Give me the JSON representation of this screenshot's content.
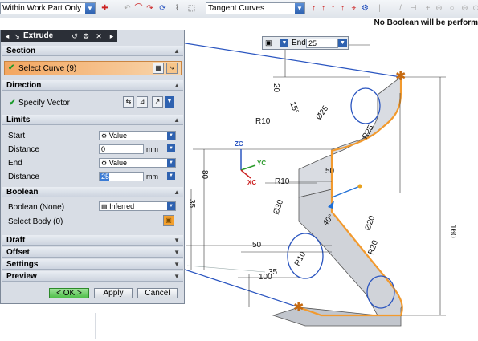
{
  "toolbar": {
    "filter_value": "Within Work Part Only",
    "curve_rule_value": "Tangent Curves"
  },
  "status": {
    "message": "No Boolean will be perform"
  },
  "dialog": {
    "title": "Extrude",
    "sections": {
      "section": "Section",
      "direction": "Direction",
      "limits": "Limits",
      "boolean": "Boolean",
      "draft": "Draft",
      "offset": "Offset",
      "settings": "Settings",
      "preview": "Preview"
    },
    "select_curve": "Select Curve (9)",
    "specify_vector": "Specify Vector",
    "limits": {
      "start_label": "Start",
      "start_value": "Value",
      "start_distance_label": "Distance",
      "start_distance": "0",
      "start_units": "mm",
      "end_label": "End",
      "end_value": "Value",
      "end_distance_label": "Distance",
      "end_distance": "25",
      "end_units": "mm"
    },
    "boolean": {
      "label": "Boolean (None)",
      "value": "Inferred",
      "select_body": "Select Body (0)"
    },
    "buttons": {
      "ok": "< OK >",
      "apply": "Apply",
      "cancel": "Cancel"
    }
  },
  "end_handle": {
    "label": "End",
    "value": "25"
  },
  "drawing": {
    "dims": [
      "20",
      "15°",
      "Ø25",
      "R25",
      "R10",
      "50",
      "R10",
      "80",
      "35",
      "Ø30",
      "40°",
      "Ø20",
      "R20",
      "R10",
      "50",
      "35",
      "100",
      "160"
    ],
    "axes": {
      "zc": "ZC",
      "yc": "YC",
      "xc": "XC"
    }
  },
  "colors": {
    "accent": "#3a7bd5",
    "selection": "#f3a660",
    "curve": "#f29a2e",
    "dimension": "#2a2a2a"
  }
}
